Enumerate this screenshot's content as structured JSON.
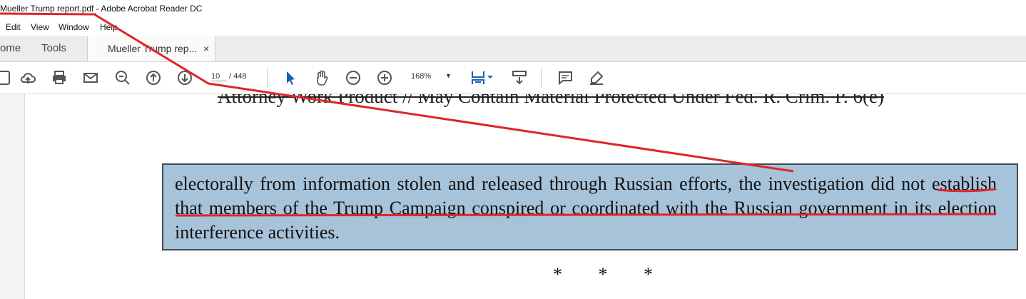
{
  "window": {
    "title": "Mueller Trump report.pdf - Adobe Acrobat Reader DC"
  },
  "menu": {
    "items": [
      "Edit",
      "View",
      "Window",
      "Help"
    ]
  },
  "tabs": {
    "home": "ome",
    "tools": "Tools",
    "document": "Mueller Trump rep...",
    "close": "×"
  },
  "toolbar": {
    "current_page": "10",
    "page_separator": "/",
    "total_pages": "448",
    "zoom": "168%",
    "icons": [
      "save-icon",
      "upload-icon",
      "print-icon",
      "email-icon",
      "zoom-out-search-icon",
      "previous-page-icon",
      "next-page-icon",
      "select-tool-icon",
      "hand-tool-icon",
      "zoom-out-icon",
      "zoom-in-icon",
      "page-fit-icon",
      "scroll-mode-icon",
      "comment-icon",
      "highlight-pen-icon"
    ]
  },
  "document": {
    "header": "Attorney Work Product // May Contain Material Protected Under Fed. R. Crim. P. 6(e)",
    "paragraph": "electorally from information stolen and released through Russian efforts, the investigation did not establish that members of the Trump Campaign conspired or coordinated with the Russian government in its election interference activities.",
    "separator": "* * *"
  },
  "colors": {
    "highlight": "#a6c3da",
    "annotation": "#e0242c",
    "tool_blue": "#1a5fb4"
  }
}
